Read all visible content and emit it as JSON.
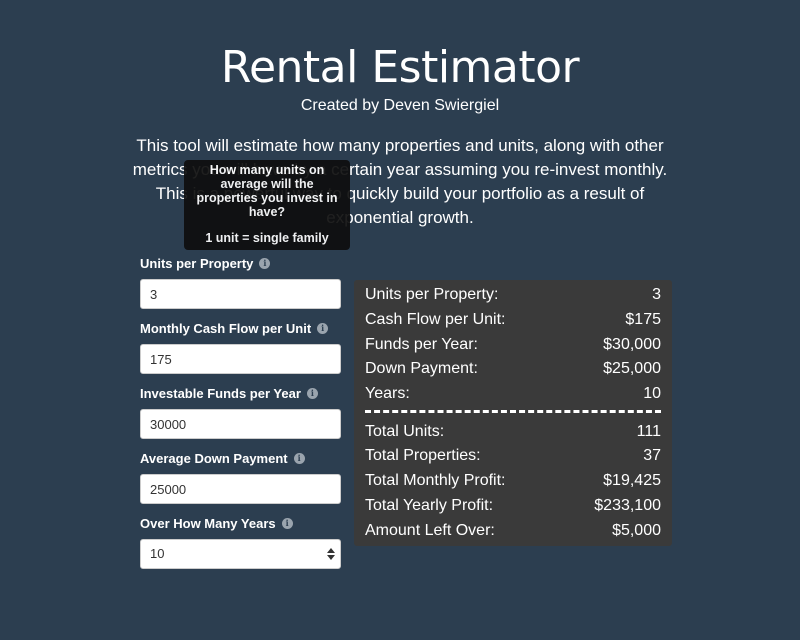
{
  "header": {
    "title": "Rental Estimator",
    "subtitle": "Created by Deven Swiergiel"
  },
  "intro": {
    "text": "This tool will estimate how many properties and units, along with other metrics you will have by a certain year assuming you re-invest monthly. This is a powerful way to quickly build your portfolio as a result of exponential growth."
  },
  "tooltip": {
    "question": "How many units on average will the properties you invest in have?",
    "note": "1 unit = single family"
  },
  "form": {
    "units_label": "Units per Property",
    "units_value": "3",
    "cashflow_label": "Monthly Cash Flow per Unit",
    "cashflow_value": "175",
    "funds_label": "Investable Funds per Year",
    "funds_value": "30000",
    "down_label": "Average Down Payment",
    "down_value": "25000",
    "years_label": "Over How Many Years",
    "years_value": "10"
  },
  "info_icon": "info-circle-icon",
  "results": {
    "inputs": [
      {
        "label": "Units per Property:",
        "value": "3"
      },
      {
        "label": "Cash Flow per Unit:",
        "value": "$175"
      },
      {
        "label": "Funds per Year:",
        "value": "$30,000"
      },
      {
        "label": "Down Payment:",
        "value": "$25,000"
      },
      {
        "label": "Years:",
        "value": "10"
      }
    ],
    "outputs": [
      {
        "label": "Total Units:",
        "value": "111"
      },
      {
        "label": "Total Properties:",
        "value": "37"
      },
      {
        "label": "Total Monthly Profit:",
        "value": "$19,425"
      },
      {
        "label": "Total Yearly Profit:",
        "value": "$233,100"
      },
      {
        "label": "Amount Left Over:",
        "value": "$5,000"
      }
    ]
  },
  "colors": {
    "background": "#2c3e50",
    "results_panel": "#3a3a3a",
    "tooltip": "#0e0e0e"
  }
}
